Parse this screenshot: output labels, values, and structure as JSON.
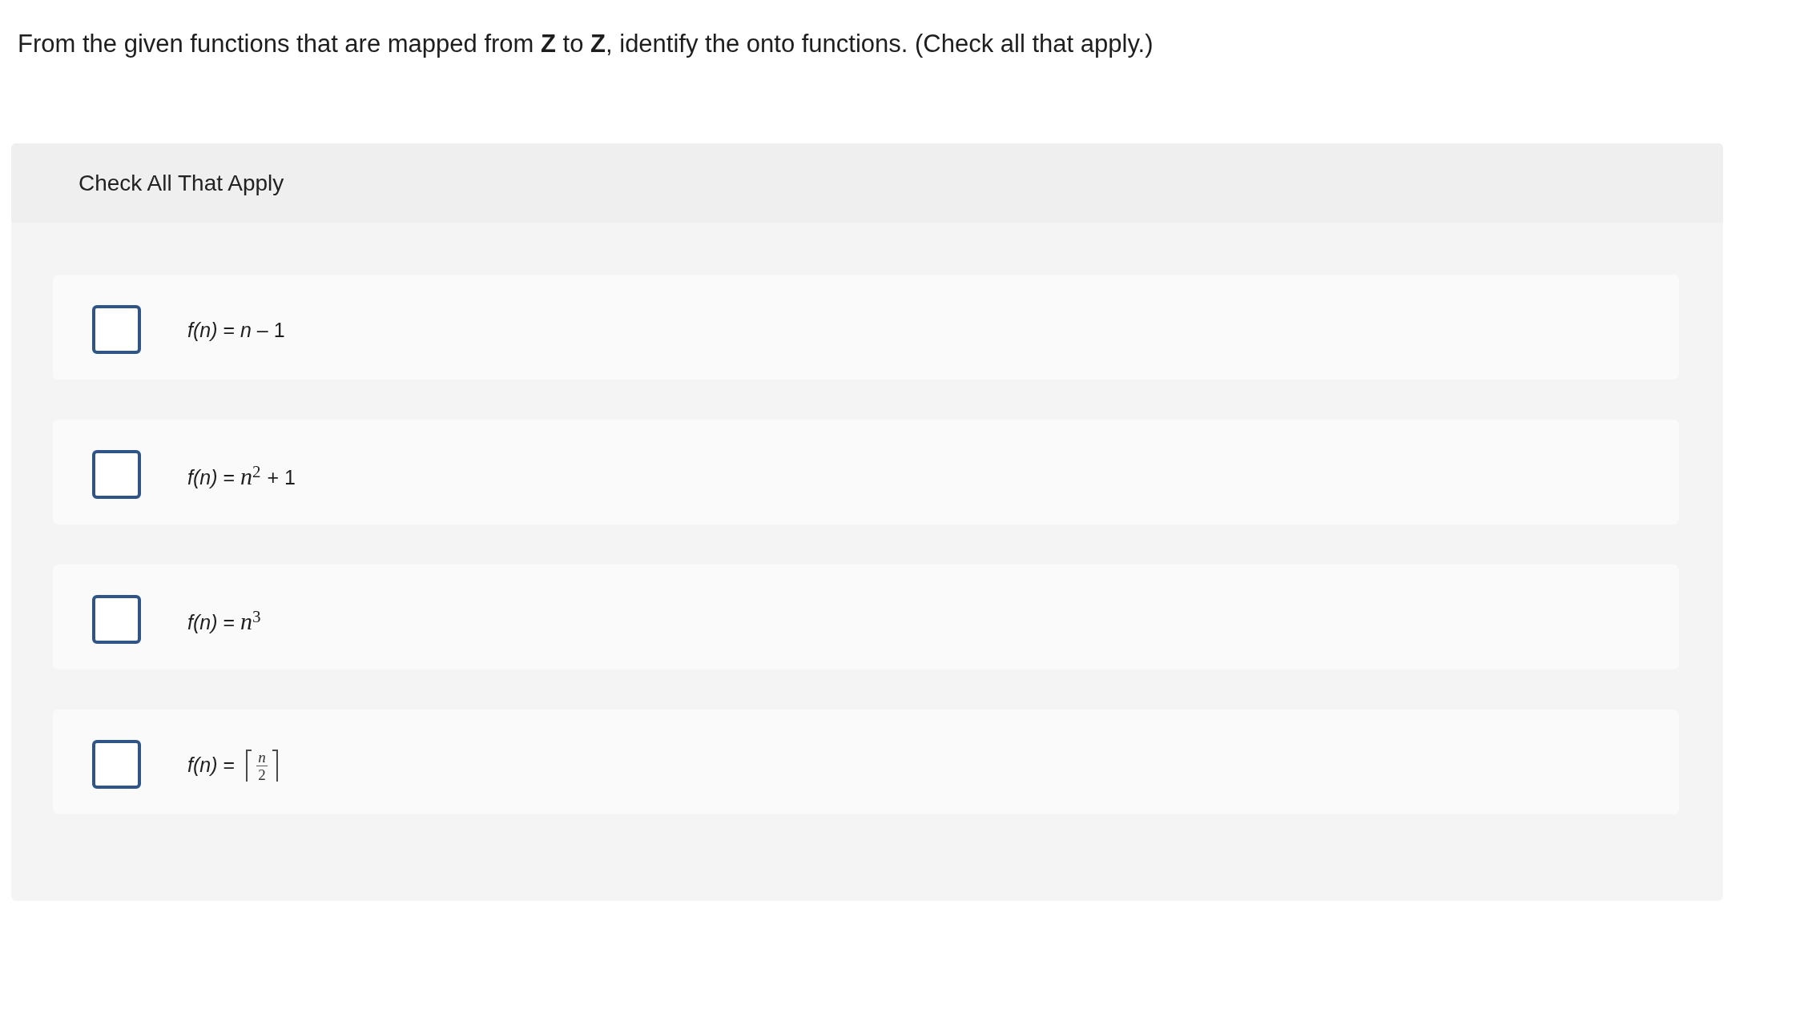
{
  "question": "From the given functions that are mapped from **Z** to **Z**, identify the onto functions. (Check all that apply.)",
  "panel": {
    "header": "Check All That Apply",
    "options": [
      {
        "kind": "linear",
        "checked": false,
        "formula": "*f(n)* = *n* – 1"
      },
      {
        "kind": "power",
        "checked": false,
        "formula": "*f(n)* = *n*$^{2}$ + 1"
      },
      {
        "kind": "power",
        "checked": false,
        "formula": "*f(n)* = *n*$^{3}$"
      },
      {
        "kind": "ceiling",
        "checked": false,
        "formula": "*f(n)* =",
        "numerator": "n",
        "denominator": "2"
      }
    ]
  }
}
